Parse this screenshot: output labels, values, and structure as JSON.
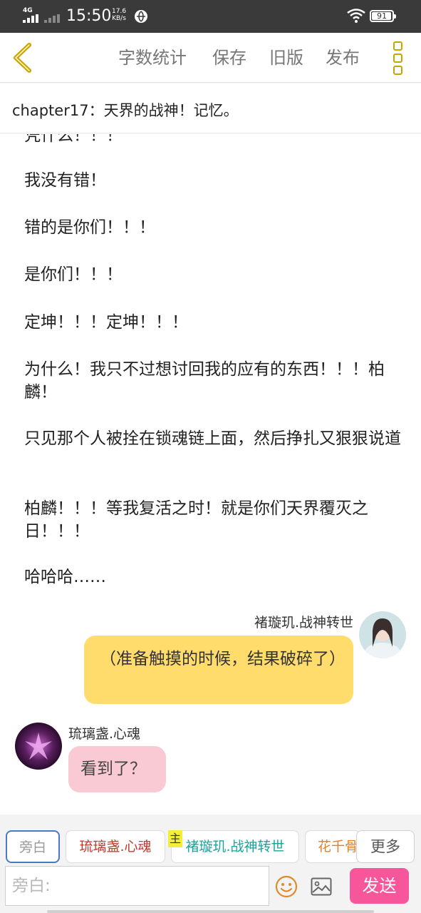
{
  "status_bar": {
    "network": "4G",
    "time": "15:50",
    "speed_value": "17.6",
    "speed_unit": "KB/s",
    "battery": "91",
    "battery_level": 0.91
  },
  "header": {
    "actions": [
      "字数统计",
      "保存",
      "旧版",
      "发布"
    ]
  },
  "chapter": {
    "title": "chapter17：天界的战神！记忆。"
  },
  "content": {
    "paragraphs": [
      "凭什么！！！",
      "我没有错！",
      "错的是你们！！！",
      "是你们！！！",
      "定坤！！！定坤！！！",
      "为什么！我只不过想讨回我的应有的东西！！！柏麟！",
      "只见那个人被拴在锁魂链上面，然后挣扎又狠狠说道",
      "柏麟！！！等我复活之时！就是你们天界覆灭之日！！！",
      "哈哈哈……"
    ]
  },
  "messages": [
    {
      "sender": "褚璇玑.战神转世",
      "text": "（准备触摸的时候，结果破碎了）",
      "side": "right",
      "color": "#ffdc6b"
    },
    {
      "sender": "琉璃盏.心魂",
      "text": "看到了？",
      "side": "left",
      "color": "#f9c9d4"
    }
  ],
  "roles": {
    "items": [
      {
        "label": "旁白",
        "color": "#999999"
      },
      {
        "label": "琉璃盏.心魂",
        "color": "#c0392b"
      },
      {
        "label": "褚璇玑.战神转世",
        "color": "#1aa39a"
      },
      {
        "label": "花千骨",
        "color": "#e67e22"
      }
    ],
    "owner_tag": "主",
    "more_label": "更多"
  },
  "input": {
    "placeholder": "旁白:",
    "value": "",
    "send_label": "发送"
  },
  "colors": {
    "accent_gold": "#c9a400",
    "send_pink": "#f7569a",
    "active_role_border": "#4a78c8"
  },
  "icons": [
    "back-icon",
    "more-icon",
    "emoji-icon",
    "image-icon",
    "wifi-icon",
    "signal-icon",
    "globe-icon",
    "battery-icon"
  ]
}
